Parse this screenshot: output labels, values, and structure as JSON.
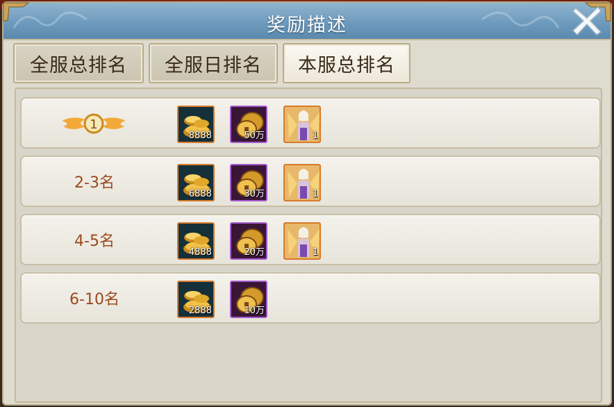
{
  "window": {
    "title": "奖励描述"
  },
  "tabs": [
    {
      "label": "全服总排名",
      "state": "inactive"
    },
    {
      "label": "全服日排名",
      "state": "inactive"
    },
    {
      "label": "本服总排名",
      "state": "active"
    }
  ],
  "rewards": [
    {
      "rank": "1",
      "items": [
        {
          "icon": "gold-ingot-icon",
          "qty": "8888"
        },
        {
          "icon": "coin-icon",
          "qty": "50万"
        },
        {
          "icon": "winged-hero-icon",
          "qty": "1"
        }
      ]
    },
    {
      "rank": "2-3名",
      "items": [
        {
          "icon": "gold-ingot-icon",
          "qty": "6888"
        },
        {
          "icon": "coin-icon",
          "qty": "30万"
        },
        {
          "icon": "winged-hero-icon",
          "qty": "1"
        }
      ]
    },
    {
      "rank": "4-5名",
      "items": [
        {
          "icon": "gold-ingot-icon",
          "qty": "4888"
        },
        {
          "icon": "coin-icon",
          "qty": "20万"
        },
        {
          "icon": "winged-hero-icon",
          "qty": "1"
        }
      ]
    },
    {
      "rank": "6-10名",
      "items": [
        {
          "icon": "gold-ingot-icon",
          "qty": "2888"
        },
        {
          "icon": "coin-icon",
          "qty": "10万"
        }
      ]
    }
  ],
  "colors": {
    "title_bar": "#6e9bbd",
    "rank_text": "#9a4a1e",
    "item_border_orange": "#d77a2a",
    "item_border_purple": "#a45bd0"
  }
}
